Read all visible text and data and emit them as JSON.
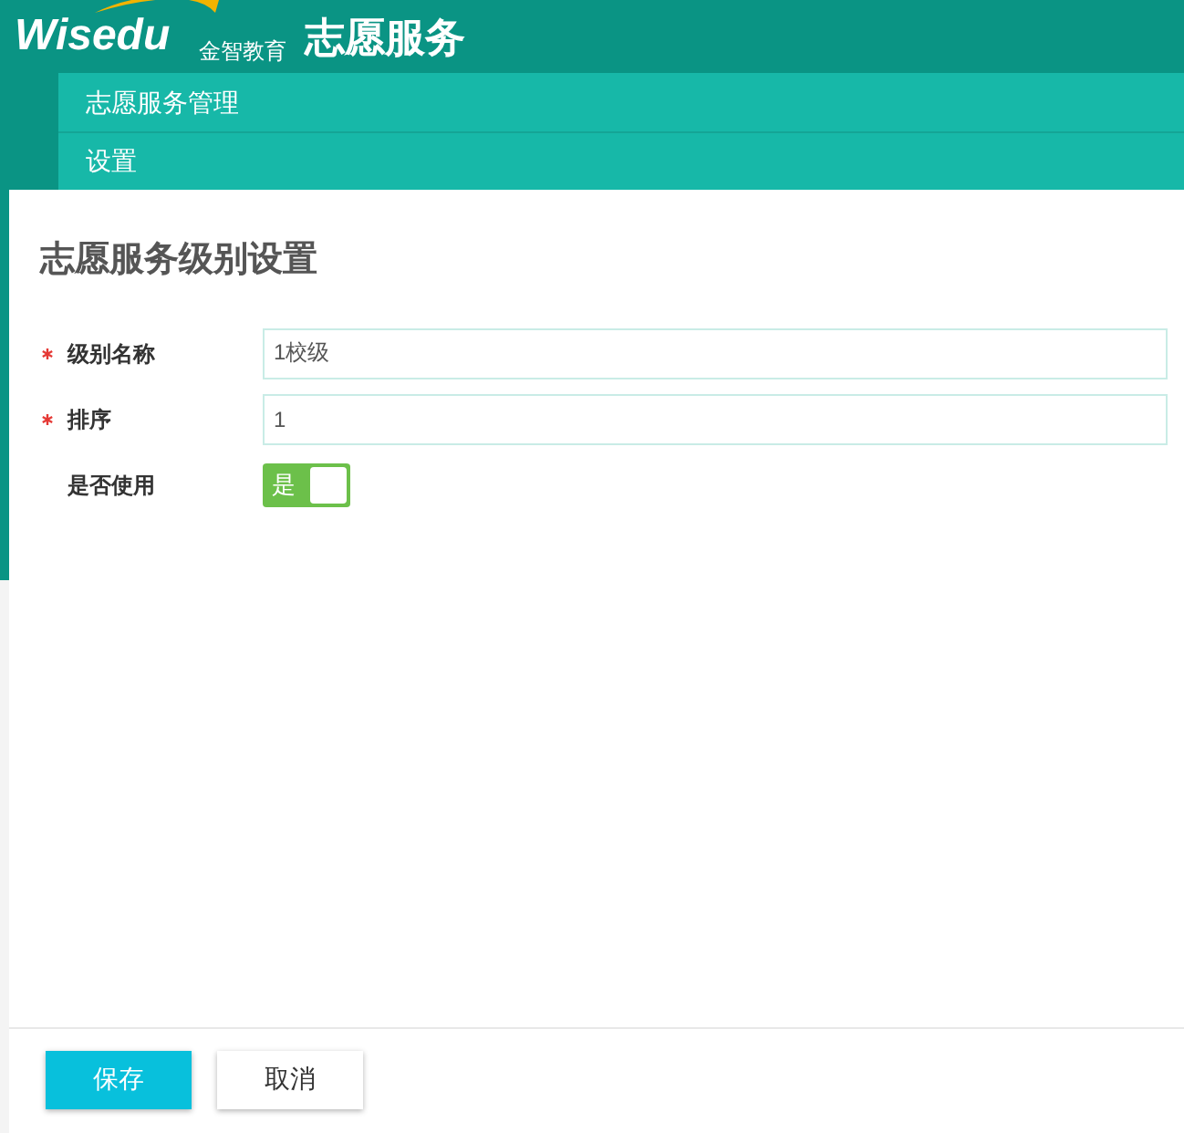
{
  "header": {
    "logo_text": "Wisedu",
    "logo_subtitle": "金智教育",
    "app_title": "志愿服务"
  },
  "menu": [
    {
      "label": "志愿服务管理"
    },
    {
      "label": "设置"
    }
  ],
  "dialog": {
    "title": "志愿服务级别设置",
    "fields": [
      {
        "kind": "text",
        "label": "级别名称",
        "required": true,
        "value": "1校级"
      },
      {
        "kind": "text",
        "label": "排序",
        "required": true,
        "value": "1"
      },
      {
        "kind": "switch",
        "label": "是否使用",
        "required": false,
        "on": true,
        "on_text": "是"
      }
    ],
    "buttons": [
      {
        "label": "保存",
        "kind": "primary"
      },
      {
        "label": "取消",
        "kind": "secondary"
      }
    ]
  }
}
